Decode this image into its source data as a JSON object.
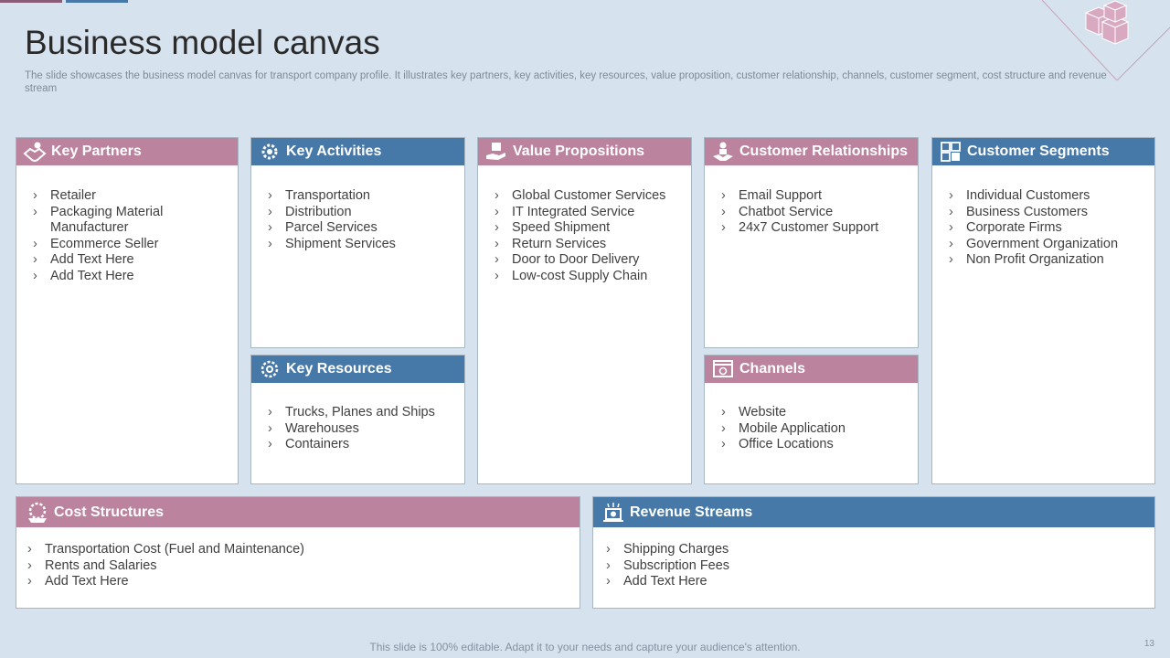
{
  "page": {
    "title": "Business model canvas",
    "subtitle": "The slide showcases the business model canvas for transport company profile. It illustrates key partners, key activities, key resources, value proposition, customer relationship, channels, customer segment, cost structure and revenue stream",
    "footer": "This slide is 100% editable. Adapt it to your needs and capture your audience's attention.",
    "page_number": "13"
  },
  "colors": {
    "pink": "#bc839f",
    "blue": "#4779a8",
    "background": "#d6e3ee"
  },
  "sections": {
    "key_partners": {
      "title": "Key Partners",
      "icon": "handshake-heart-icon",
      "items": [
        "Retailer",
        "Packaging Material Manufacturer",
        "Ecommerce Seller",
        "Add Text Here",
        "Add Text Here"
      ]
    },
    "key_activities": {
      "title": "Key Activities",
      "icon": "gear-icon",
      "items": [
        "Transportation",
        "Distribution",
        "Parcel Services",
        "Shipment Services"
      ]
    },
    "key_resources": {
      "title": "Key Resources",
      "icon": "gear-network-icon",
      "items": [
        "Trucks, Planes and Ships",
        "Warehouses",
        "Containers"
      ]
    },
    "value_propositions": {
      "title": "Value Propositions",
      "icon": "hand-box-icon",
      "items": [
        "Global Customer Services",
        "IT Integrated Service",
        "Speed Shipment",
        "Return Services",
        "Door to Door Delivery",
        "Low-cost Supply Chain"
      ]
    },
    "customer_relationships": {
      "title": "Customer Relationships",
      "icon": "person-handshake-icon",
      "items": [
        "Email Support",
        "Chatbot Service",
        "24x7 Customer Support"
      ]
    },
    "channels": {
      "title": "Channels",
      "icon": "web-channels-icon",
      "items": [
        "Website",
        "Mobile Application",
        "Office Locations"
      ]
    },
    "customer_segments": {
      "title": "Customer Segments",
      "icon": "segments-grid-icon",
      "items": [
        "Individual  Customers",
        "Business Customers",
        "Corporate Firms",
        "Government Organization",
        "Non Profit Organization"
      ]
    },
    "cost_structures": {
      "title": "Cost Structures",
      "icon": "cost-gear-icon",
      "items": [
        "Transportation Cost (Fuel and Maintenance)",
        "Rents and Salaries",
        "Add Text Here"
      ]
    },
    "revenue_streams": {
      "title": "Revenue Streams",
      "icon": "revenue-laptop-icon",
      "items": [
        "Shipping Charges",
        "Subscription Fees",
        "Add Text Here"
      ]
    }
  }
}
